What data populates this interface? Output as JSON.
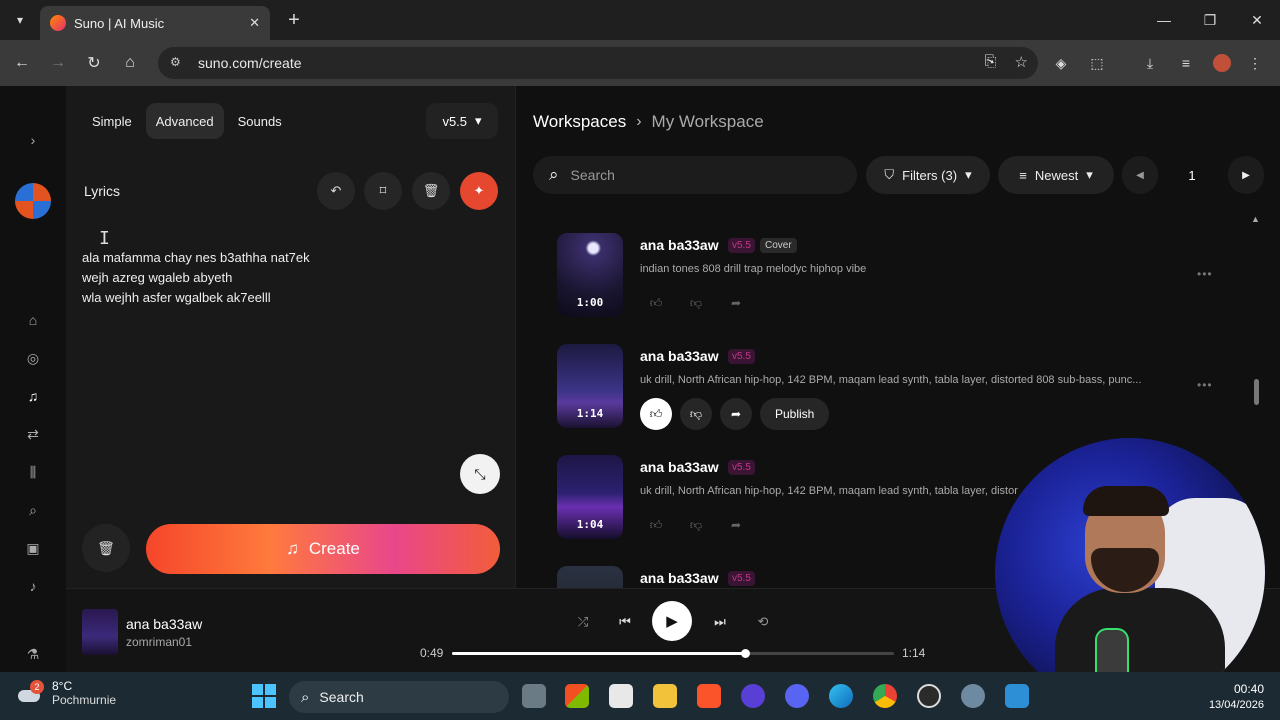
{
  "browser": {
    "tab_title": "Suno | AI Music",
    "tab_close": "✕",
    "new_tab": "+",
    "url": "suno.com/create",
    "window": {
      "minimize": "—",
      "maximize": "❐",
      "close": "✕"
    }
  },
  "create": {
    "modes": [
      "Simple",
      "Advanced",
      "Sounds"
    ],
    "active_mode": "Advanced",
    "version": "v5.5",
    "lyrics_label": "Lyrics",
    "lyrics": [
      "ala mafamma chay nes b3athha nat7ek",
      "wejh azreg wgaleb abyeth",
      "wla wejhh asfer wgalbek ak7eelll"
    ],
    "create_label": "Create"
  },
  "workspace": {
    "breadcrumb_root": "Workspaces",
    "breadcrumb_current": "My Workspace",
    "search_placeholder": "Search",
    "filters_label": "Filters (3)",
    "sort_label": "Newest",
    "page": "1",
    "songs": [
      {
        "title": "ana ba33aw",
        "version": "v5.5",
        "tag": "Cover",
        "desc": "indian tones 808 drill trap melodyc hiphop vibe",
        "duration": "1:00",
        "liked": false,
        "publish": ""
      },
      {
        "title": "ana ba33aw",
        "version": "v5.5",
        "tag": "",
        "desc": "uk drill, North African hip-hop, 142 BPM, maqam lead synth, tabla layer, distorted 808 sub-bass, punc...",
        "duration": "1:14",
        "liked": true,
        "publish": "Publish"
      },
      {
        "title": "ana ba33aw",
        "version": "v5.5",
        "tag": "",
        "desc": "uk drill, North African hip-hop, 142 BPM, maqam lead synth, tabla layer, distor",
        "duration": "1:04",
        "liked": false,
        "publish": ""
      },
      {
        "title": "ana ba33aw",
        "version": "v5.5",
        "tag": "",
        "desc": "",
        "duration": "",
        "liked": false,
        "publish": ""
      }
    ]
  },
  "player": {
    "title": "ana ba33aw",
    "artist": "zomriman01",
    "elapsed": "0:49",
    "total": "1:14",
    "progress_fraction": 0.662
  },
  "taskbar": {
    "temperature": "8°C",
    "condition": "Pochmurnie",
    "weather_badge": "2",
    "search_label": "Search",
    "time": "00:40",
    "date": "13/04/2026"
  },
  "colors": {
    "accent": "#e5472f",
    "version_badge": "#c0388a",
    "background": "#101010"
  }
}
